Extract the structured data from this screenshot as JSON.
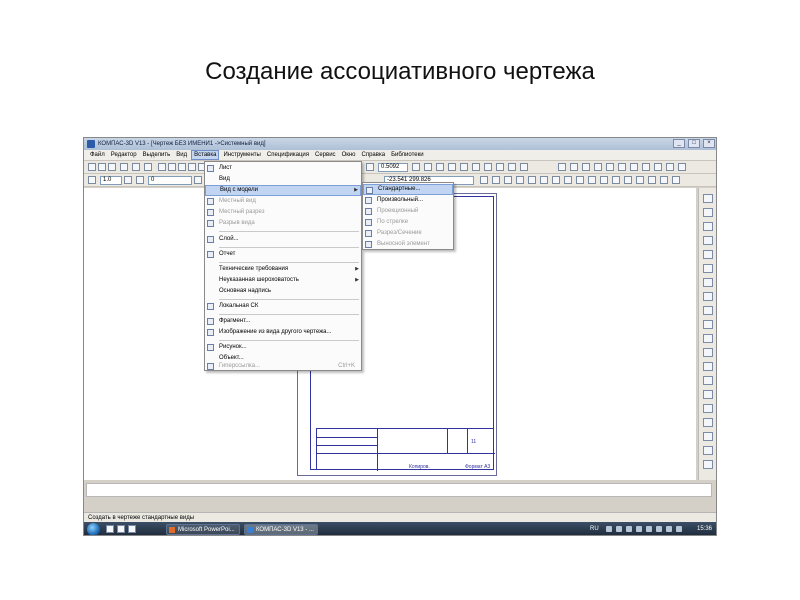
{
  "slide": {
    "title": "Создание ассоциативного чертежа"
  },
  "window": {
    "title": "КОМПАС-3D V13 - [Чертеж БЕЗ ИМЕНИ1 ->Системный вид]",
    "controls": [
      "_",
      "□",
      "×"
    ]
  },
  "menubar": {
    "items": [
      "Файл",
      "Редактор",
      "Выделить",
      "Вид",
      "Вставка",
      "Инструменты",
      "Спецификация",
      "Сервис",
      "Окно",
      "Справка",
      "Библиотеки"
    ],
    "active_index": 4
  },
  "toolbar": {
    "scale_value": "1.0",
    "layer_value": "0",
    "zoom_value": "0.5092",
    "coords_value": "-23.541   299.826"
  },
  "insert_menu": {
    "items": [
      {
        "label": "Лист",
        "disabled": false,
        "submenu": false,
        "icon": "sheet-icon"
      },
      {
        "label": "Вид",
        "disabled": false,
        "submenu": false,
        "icon": ""
      },
      {
        "label": "Вид с модели",
        "disabled": false,
        "submenu": true,
        "highlighted": true,
        "icon": ""
      },
      {
        "label": "Местный вид",
        "disabled": true,
        "submenu": false,
        "icon": "local-view-icon"
      },
      {
        "label": "Местный разрез",
        "disabled": true,
        "submenu": false,
        "icon": "local-section-icon"
      },
      {
        "label": "Разрыв вида",
        "disabled": true,
        "submenu": false,
        "icon": "view-break-icon"
      },
      {
        "label": "Слой...",
        "disabled": false,
        "submenu": false,
        "icon": "layer-icon"
      },
      {
        "label": "Отчет",
        "disabled": false,
        "submenu": false,
        "icon": "report-icon"
      },
      {
        "label": "Технические требования",
        "disabled": false,
        "submenu": true,
        "icon": ""
      },
      {
        "label": "Неуказанная шероховатость",
        "disabled": false,
        "submenu": true,
        "icon": ""
      },
      {
        "label": "Основная надпись",
        "disabled": false,
        "submenu": false,
        "icon": ""
      },
      {
        "label": "Локальная СК",
        "disabled": false,
        "submenu": false,
        "icon": "local-cs-icon"
      },
      {
        "label": "Фрагмент...",
        "disabled": false,
        "submenu": false,
        "icon": "fragment-icon"
      },
      {
        "label": "Изображение из вида другого чертежа...",
        "disabled": false,
        "submenu": false,
        "icon": "image-from-view-icon"
      },
      {
        "label": "Рисунок...",
        "disabled": false,
        "submenu": false,
        "icon": "picture-icon"
      },
      {
        "label": "Объект...",
        "disabled": false,
        "submenu": false,
        "icon": ""
      },
      {
        "label": "Гиперссылка...",
        "disabled": true,
        "submenu": false,
        "icon": "hyperlink-icon",
        "shortcut": "Ctrl+K"
      }
    ]
  },
  "model_view_submenu": {
    "items": [
      {
        "label": "Стандартные...",
        "disabled": false,
        "highlighted": true,
        "icon": "standard-views-icon"
      },
      {
        "label": "Произвольный...",
        "disabled": false,
        "icon": "arbitrary-view-icon"
      },
      {
        "label": "Проекционный",
        "disabled": true,
        "icon": "projection-view-icon"
      },
      {
        "label": "По стрелке",
        "disabled": true,
        "icon": "arrow-view-icon"
      },
      {
        "label": "Разрез/Сечение",
        "disabled": true,
        "icon": "section-view-icon"
      },
      {
        "label": "Выносной элемент",
        "disabled": true,
        "icon": "detail-view-icon"
      }
    ]
  },
  "title_block": {
    "label_left": "Копиров.",
    "label_right": "Формат А3",
    "sheet_number": "11"
  },
  "status": {
    "text": "Создать в чертеже стандартные виды"
  },
  "taskbar": {
    "buttons": [
      "Microsoft PowerPoi...",
      "КОМПАС-3D V13 - ..."
    ],
    "language": "RU",
    "time": "15:36"
  },
  "colors": {
    "drawing_lines": "#3033a0",
    "menu_highlight": "#c1d4f1",
    "taskbar": "#1c2838"
  }
}
